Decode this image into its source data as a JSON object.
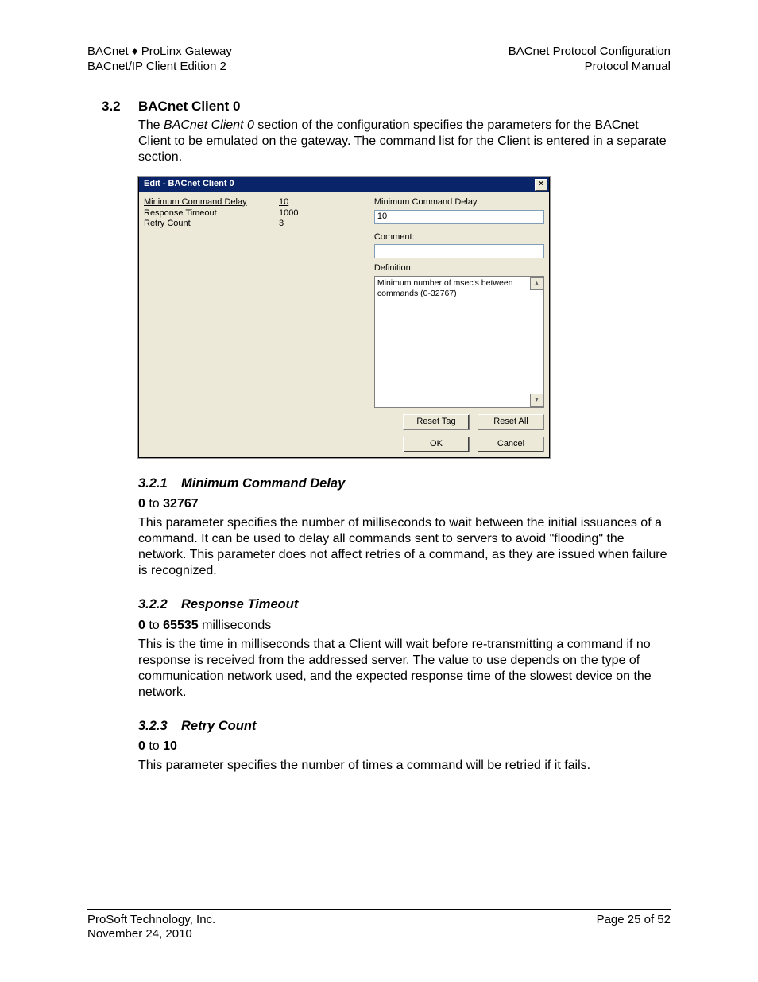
{
  "header": {
    "left1_a": "BACnet",
    "left1_sep": " ♦ ",
    "left1_b": "ProLinx Gateway",
    "left2": "BACnet/IP Client Edition 2",
    "right1": "BACnet Protocol Configuration",
    "right2": "Protocol Manual"
  },
  "section": {
    "num": "3.2",
    "title": "BACnet Client 0",
    "intro_a": "The ",
    "intro_ital": "BACnet Client 0",
    "intro_b": " section of the configuration specifies the parameters for the BACnet Client to be emulated on the gateway. The command list for the Client is entered in a separate section."
  },
  "dialog": {
    "title": "Edit - BACnet Client 0",
    "rows": [
      {
        "k": "Minimum Command Delay",
        "v": "10",
        "selected": true
      },
      {
        "k": "Response Timeout",
        "v": "1000",
        "selected": false
      },
      {
        "k": "Retry Count",
        "v": "3",
        "selected": false
      }
    ],
    "right_label": "Minimum Command Delay",
    "value_field": "10",
    "comment_label": "Comment:",
    "comment_value": "",
    "definition_label": "Definition:",
    "definition_text": "Minimum number of msec's between commands (0-32767)",
    "buttons": {
      "reset_tag": "Reset Tag",
      "reset_all": "Reset All",
      "ok": "OK",
      "cancel": "Cancel"
    }
  },
  "sub": [
    {
      "num": "3.2.1",
      "title": "Minimum Command Delay",
      "range_a": "0",
      "range_mid": " to ",
      "range_b": "32767",
      "range_tail": "",
      "body": "This parameter specifies the number of milliseconds to wait between the initial issuances of a command. It can be used to delay all commands sent to servers to avoid \"flooding\" the network. This parameter does not affect retries of a command, as they are issued when failure is recognized."
    },
    {
      "num": "3.2.2",
      "title": "Response Timeout",
      "range_a": "0",
      "range_mid": " to ",
      "range_b": "65535",
      "range_tail": " milliseconds",
      "body": "This is the time in milliseconds that a Client will wait before re-transmitting a command if no response is received from the addressed server. The value to use depends on the type of communication network used, and the expected response time of the slowest device on the network."
    },
    {
      "num": "3.2.3",
      "title": "Retry Count",
      "range_a": "0",
      "range_mid": " to ",
      "range_b": "10",
      "range_tail": "",
      "body": "This parameter specifies the number of times a command will be retried if it fails."
    }
  ],
  "footer": {
    "company": "ProSoft Technology, Inc.",
    "date": "November 24, 2010",
    "page": "Page 25 of 52"
  }
}
